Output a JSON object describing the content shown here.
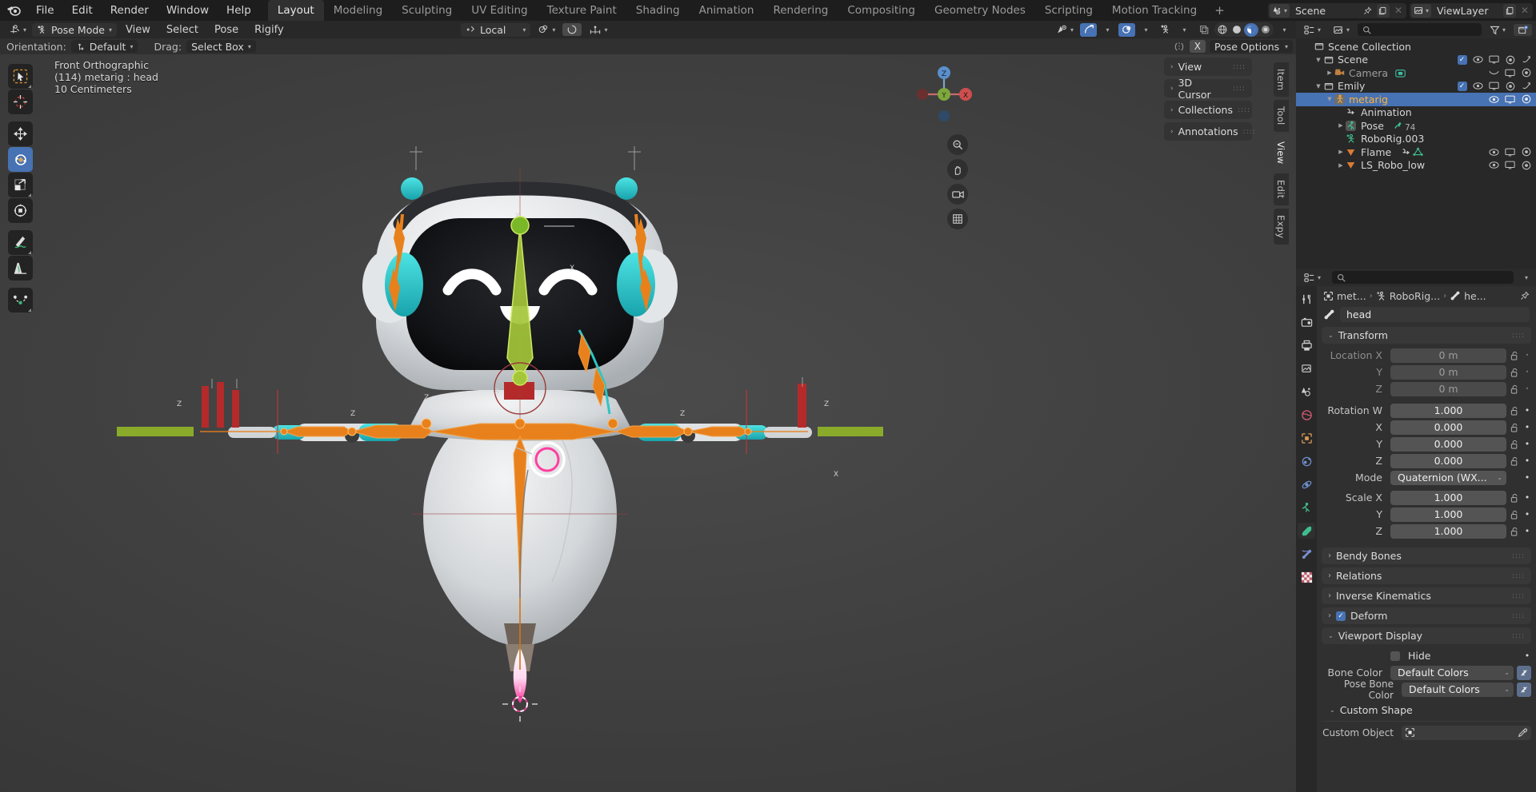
{
  "topbar": {
    "menus": [
      "File",
      "Edit",
      "Render",
      "Window",
      "Help"
    ],
    "workspaces": [
      {
        "label": "Layout",
        "active": true
      },
      {
        "label": "Modeling",
        "active": false
      },
      {
        "label": "Sculpting",
        "active": false
      },
      {
        "label": "UV Editing",
        "active": false
      },
      {
        "label": "Texture Paint",
        "active": false
      },
      {
        "label": "Shading",
        "active": false
      },
      {
        "label": "Animation",
        "active": false
      },
      {
        "label": "Rendering",
        "active": false
      },
      {
        "label": "Compositing",
        "active": false
      },
      {
        "label": "Geometry Nodes",
        "active": false
      },
      {
        "label": "Scripting",
        "active": false
      },
      {
        "label": "Motion Tracking",
        "active": false
      }
    ],
    "add_workspace": "+",
    "scene_name": "Scene",
    "viewlayer_name": "ViewLayer"
  },
  "viewport_header": {
    "mode": "Pose Mode",
    "menus": [
      "View",
      "Select",
      "Pose",
      "Rigify"
    ],
    "transform_orientation": "Local",
    "xray_label": "",
    "shading_modes": [
      "wireframe",
      "solid",
      "material-preview",
      "rendered"
    ]
  },
  "tool_settings": {
    "orientation_label": "Orientation:",
    "orientation_value": "Default",
    "drag_label": "Drag:",
    "drag_value": "Select Box",
    "pose_options": "Pose Options",
    "x_mirror": "X"
  },
  "viewport": {
    "view_name": "Front Orthographic",
    "active_object": "(114) metarig : head",
    "grid_scale": "10 Centimeters",
    "gizmo_axes": {
      "x": "X",
      "y": "Y",
      "z": "Z"
    }
  },
  "npanel": {
    "sections": [
      "View",
      "3D Cursor",
      "Collections",
      "Annotations"
    ],
    "tabs": [
      {
        "label": "Item",
        "active": false
      },
      {
        "label": "Tool",
        "active": false
      },
      {
        "label": "View",
        "active": true
      },
      {
        "label": "Edit",
        "active": false
      },
      {
        "label": "Expy",
        "active": false
      }
    ]
  },
  "toolbar": {
    "tools": [
      {
        "name": "tweak-tool",
        "active": false
      },
      {
        "name": "cursor-tool",
        "active": false
      },
      {
        "name": "move-tool",
        "active": false
      },
      {
        "name": "rotate-tool",
        "active": true
      },
      {
        "name": "scale-tool",
        "active": false
      },
      {
        "name": "transform-tool",
        "active": false
      },
      {
        "name": "annotate-tool",
        "active": false
      },
      {
        "name": "measure-tool",
        "active": false
      },
      {
        "name": "bone-curve-tool",
        "active": false
      }
    ]
  },
  "outliner": {
    "search_placeholder": "",
    "rows": [
      {
        "label": "Scene Collection",
        "indent": 0,
        "icon": "collection-icon",
        "tri": "",
        "selected": false,
        "icons": []
      },
      {
        "label": "Scene",
        "indent": 1,
        "icon": "collection-icon",
        "tri": "down",
        "selected": false,
        "icons": [
          "check",
          "eye",
          "screen",
          "camera",
          "arrow"
        ]
      },
      {
        "label": "Camera",
        "indent": 2,
        "icon": "camera-icon",
        "tri": "right",
        "selected": false,
        "icons": [
          "curve",
          "screen",
          "camera"
        ]
      },
      {
        "label": "Emily",
        "indent": 1,
        "icon": "collection-icon",
        "tri": "down",
        "selected": false,
        "icons": [
          "check",
          "eye",
          "screen",
          "camera",
          "arrow"
        ]
      },
      {
        "label": "metarig",
        "indent": 2,
        "icon": "armature-icon",
        "tri": "down",
        "selected": true,
        "icons": [
          "eye",
          "screen",
          "camera"
        ]
      },
      {
        "label": "Animation",
        "indent": 3,
        "icon": "animation-icon",
        "tri": "",
        "selected": false,
        "icons": []
      },
      {
        "label": "Pose",
        "indent": 3,
        "icon": "pose-icon",
        "tri": "right",
        "selected": false,
        "icons": [],
        "badge": "74"
      },
      {
        "label": "RoboRig.003",
        "indent": 3,
        "icon": "armature-data-icon",
        "tri": "",
        "selected": false,
        "icons": []
      },
      {
        "label": "Flame",
        "indent": 3,
        "icon": "mesh-icon",
        "tri": "right",
        "selected": false,
        "icons": [
          "eye",
          "screen",
          "camera"
        ],
        "extra": "modifier"
      },
      {
        "label": "LS_Robo_low",
        "indent": 3,
        "icon": "mesh-icon",
        "tri": "right",
        "selected": false,
        "icons": [
          "eye",
          "screen",
          "camera"
        ]
      }
    ]
  },
  "properties": {
    "search_placeholder": "",
    "breadcrumb": [
      "met...",
      "RoboRig...",
      "he..."
    ],
    "bone_name": "head",
    "panels": {
      "transform": {
        "title": "Transform",
        "rows": [
          {
            "label": "Location X",
            "value": "0 m",
            "dim": true,
            "animated": false
          },
          {
            "label": "Y",
            "value": "0 m",
            "dim": true,
            "animated": false
          },
          {
            "label": "Z",
            "value": "0 m",
            "dim": true,
            "animated": false
          },
          {
            "label": "Rotation W",
            "value": "1.000",
            "dim": false,
            "animated": true
          },
          {
            "label": "X",
            "value": "0.000",
            "dim": false,
            "animated": true
          },
          {
            "label": "Y",
            "value": "0.000",
            "dim": false,
            "animated": true
          },
          {
            "label": "Z",
            "value": "0.000",
            "dim": false,
            "animated": true
          }
        ],
        "mode_label": "Mode",
        "mode_value": "Quaternion (WX...",
        "scale_rows": [
          {
            "label": "Scale X",
            "value": "1.000"
          },
          {
            "label": "Y",
            "value": "1.000"
          },
          {
            "label": "Z",
            "value": "1.000"
          }
        ]
      },
      "collapsed": [
        {
          "title": "Bendy Bones",
          "checkbox": null
        },
        {
          "title": "Relations",
          "checkbox": null
        },
        {
          "title": "Inverse Kinematics",
          "checkbox": null
        },
        {
          "title": "Deform",
          "checkbox": true
        }
      ],
      "viewport_display": {
        "title": "Viewport Display",
        "hide_label": "Hide",
        "hide_checked": false,
        "bone_color_label": "Bone Color",
        "bone_color_value": "Default Colors",
        "pose_bone_color_label": "Pose Bone Color",
        "pose_bone_color_value": "Default Colors",
        "custom_shape_title": "Custom Shape",
        "custom_object_label": "Custom Object",
        "custom_object_value": ""
      }
    }
  },
  "colors": {
    "accent_blue": "#4772b3",
    "selected_orange": "#ffb238",
    "bone_orange": "#e8811c",
    "bone_green": "#a4c639",
    "teal": "#2ec4c4",
    "red": "#b42a2a"
  }
}
